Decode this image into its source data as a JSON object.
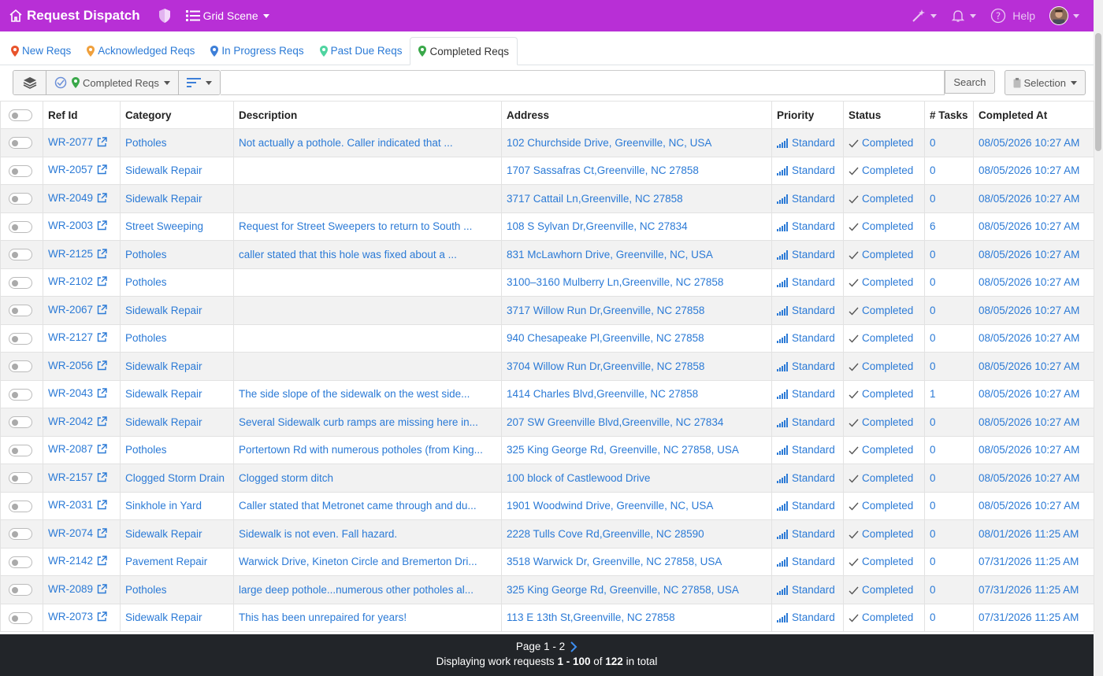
{
  "app": {
    "title": "Request Dispatch",
    "scene_label": "Grid Scene"
  },
  "topbar": {
    "help_label": "Help"
  },
  "tabs": [
    {
      "label": "New Reqs",
      "color": "#e8542c"
    },
    {
      "label": "Acknowledged Reqs",
      "color": "#f0a03c"
    },
    {
      "label": "In Progress Reqs",
      "color": "#3d7fd8"
    },
    {
      "label": "Past Due Reqs",
      "color": "#4fd4a0"
    },
    {
      "label": "Completed Reqs",
      "color": "#3aa84a",
      "active": true
    }
  ],
  "toolbar": {
    "filter_label": "Completed Reqs",
    "search_placeholder": "",
    "search_button": "Search",
    "selection_button": "Selection"
  },
  "columns": [
    "Ref Id",
    "Category",
    "Description",
    "Address",
    "Priority",
    "Status",
    "# Tasks",
    "Completed At"
  ],
  "rows": [
    [
      "WR-2077",
      "Potholes",
      "Not actually a pothole. Caller indicated that ...",
      "102 Churchside Drive, Greenville, NC, USA",
      "Standard",
      "Completed",
      "0",
      "08/05/2026 10:27 AM"
    ],
    [
      "WR-2057",
      "Sidewalk Repair",
      "",
      "1707 Sassafras Ct,Greenville, NC 27858",
      "Standard",
      "Completed",
      "0",
      "08/05/2026 10:27 AM"
    ],
    [
      "WR-2049",
      "Sidewalk Repair",
      "",
      "3717 Cattail Ln,Greenville, NC 27858",
      "Standard",
      "Completed",
      "0",
      "08/05/2026 10:27 AM"
    ],
    [
      "WR-2003",
      "Street Sweeping",
      "Request for Street Sweepers to return to South ...",
      "108 S Sylvan Dr,Greenville, NC 27834",
      "Standard",
      "Completed",
      "6",
      "08/05/2026 10:27 AM"
    ],
    [
      "WR-2125",
      "Potholes",
      "caller stated that this hole was fixed about a ...",
      "831 McLawhorn Drive, Greenville, NC, USA",
      "Standard",
      "Completed",
      "0",
      "08/05/2026 10:27 AM"
    ],
    [
      "WR-2102",
      "Potholes",
      "",
      "3100–3160 Mulberry Ln,Greenville, NC 27858",
      "Standard",
      "Completed",
      "0",
      "08/05/2026 10:27 AM"
    ],
    [
      "WR-2067",
      "Sidewalk Repair",
      "",
      "3717 Willow Run Dr,Greenville, NC 27858",
      "Standard",
      "Completed",
      "0",
      "08/05/2026 10:27 AM"
    ],
    [
      "WR-2127",
      "Potholes",
      "",
      "940 Chesapeake Pl,Greenville, NC 27858",
      "Standard",
      "Completed",
      "0",
      "08/05/2026 10:27 AM"
    ],
    [
      "WR-2056",
      "Sidewalk Repair",
      "",
      "3704 Willow Run Dr,Greenville, NC 27858",
      "Standard",
      "Completed",
      "0",
      "08/05/2026 10:27 AM"
    ],
    [
      "WR-2043",
      "Sidewalk Repair",
      "The side slope of the sidewalk on the west side...",
      "1414 Charles Blvd,Greenville, NC 27858",
      "Standard",
      "Completed",
      "1",
      "08/05/2026 10:27 AM"
    ],
    [
      "WR-2042",
      "Sidewalk Repair",
      "Several Sidewalk curb ramps are missing here in...",
      "207 SW Greenville Blvd,Greenville, NC 27834",
      "Standard",
      "Completed",
      "0",
      "08/05/2026 10:27 AM"
    ],
    [
      "WR-2087",
      "Potholes",
      "Portertown Rd with numerous potholes (from King...",
      "325 King George Rd, Greenville, NC 27858, USA",
      "Standard",
      "Completed",
      "0",
      "08/05/2026 10:27 AM"
    ],
    [
      "WR-2157",
      "Clogged Storm Drain",
      "Clogged storm ditch",
      "100 block of Castlewood Drive",
      "Standard",
      "Completed",
      "0",
      "08/05/2026 10:27 AM"
    ],
    [
      "WR-2031",
      "Sinkhole in Yard",
      "Caller stated that Metronet came through and du...",
      "1901 Woodwind Drive, Greenville, NC, USA",
      "Standard",
      "Completed",
      "0",
      "08/05/2026 10:27 AM"
    ],
    [
      "WR-2074",
      "Sidewalk Repair",
      "Sidewalk is not even. Fall hazard.",
      "2228 Tulls Cove Rd,Greenville, NC 28590",
      "Standard",
      "Completed",
      "0",
      "08/01/2026 11:25 AM"
    ],
    [
      "WR-2142",
      "Pavement Repair",
      "Warwick Drive, Kineton Circle and Bremerton Dri...",
      "3518 Warwick Dr, Greenville, NC 27858, USA",
      "Standard",
      "Completed",
      "0",
      "07/31/2026 11:25 AM"
    ],
    [
      "WR-2089",
      "Potholes",
      "large deep pothole...numerous other potholes al...",
      "325 King George Rd, Greenville, NC 27858, USA",
      "Standard",
      "Completed",
      "0",
      "07/31/2026 11:25 AM"
    ],
    [
      "WR-2073",
      "Sidewalk Repair",
      "This has been unrepaired for years!",
      "113 E 13th St,Greenville, NC 27858",
      "Standard",
      "Completed",
      "0",
      "07/31/2026 11:25 AM"
    ]
  ],
  "footer": {
    "page_label": "Page 1 - 2",
    "display_prefix": "Displaying work requests",
    "range": "1 - 100",
    "of_label": "of",
    "total": "122",
    "suffix": "in total"
  },
  "colors": {
    "topbar": "#b82fd6",
    "link": "#2b7ad6",
    "footer": "#222529"
  }
}
